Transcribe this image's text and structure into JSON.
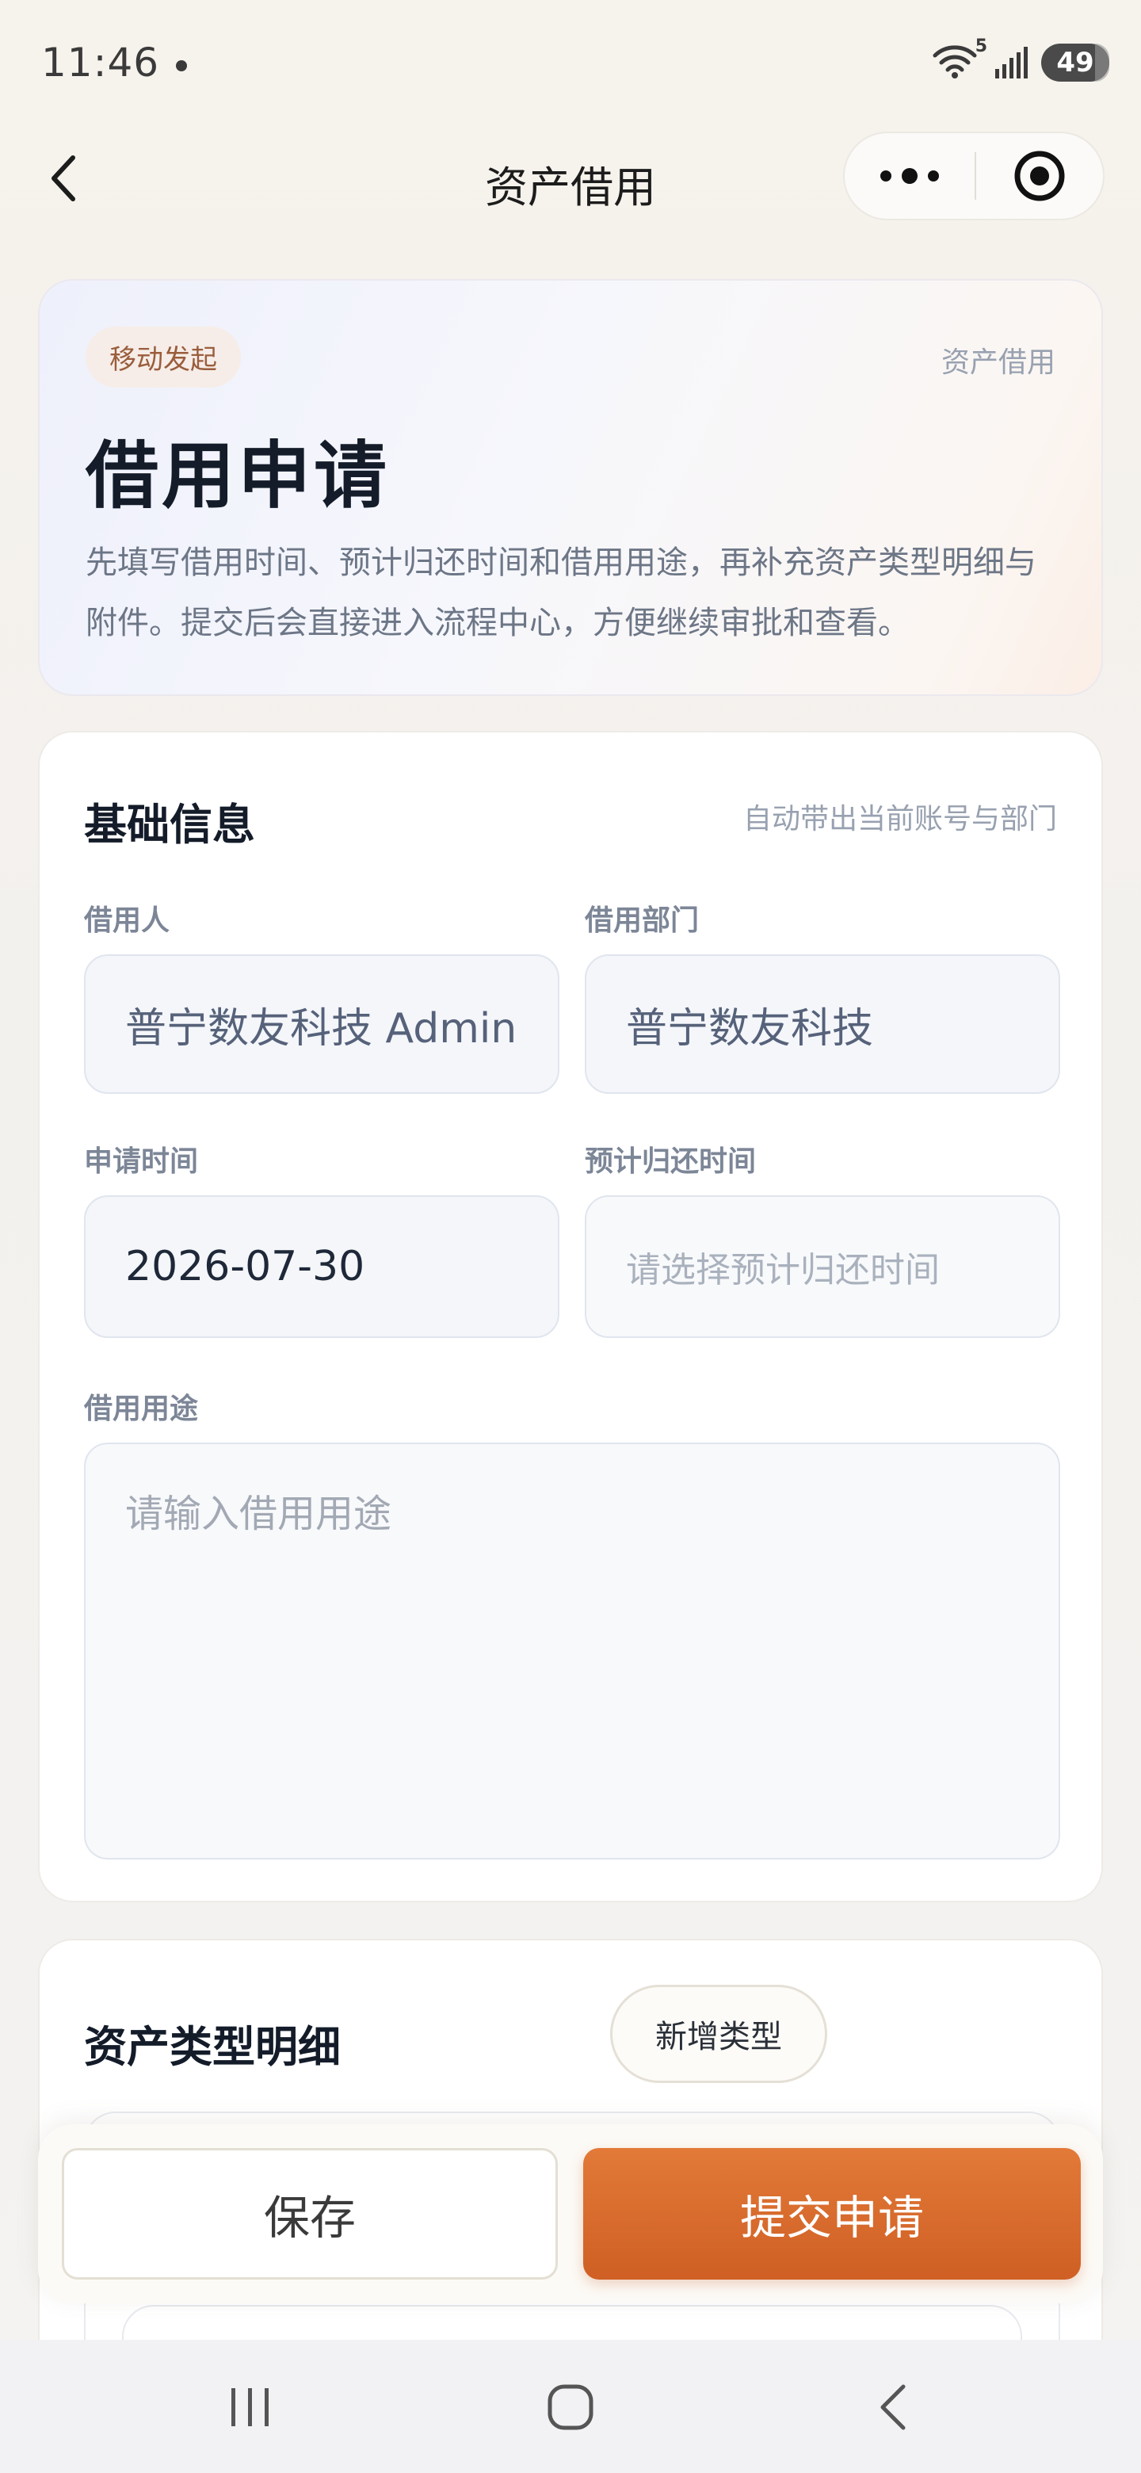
{
  "status_bar": {
    "time": "11:46",
    "wifi_badge": "5",
    "battery": "49"
  },
  "nav": {
    "title": "资产借用"
  },
  "hero": {
    "badge": "移动发起",
    "tag": "资产借用",
    "title": "借用申请",
    "description": "先填写借用时间、预计归还时间和借用用途，再补充资产类型明细与附件。提交后会直接进入流程中心，方便继续审批和查看。"
  },
  "basic_info": {
    "title": "基础信息",
    "hint": "自动带出当前账号与部门",
    "borrower": {
      "label": "借用人",
      "value": "普宁数友科技 Admin"
    },
    "department": {
      "label": "借用部门",
      "value": "普宁数友科技"
    },
    "apply_time": {
      "label": "申请时间",
      "value": "2026-07-30"
    },
    "return_time": {
      "label": "预计归还时间",
      "placeholder": "请选择预计归还时间"
    },
    "purpose": {
      "label": "借用用途",
      "placeholder": "请输入借用用途"
    }
  },
  "asset_types": {
    "title": "资产类型明细",
    "add_button": "新增类型"
  },
  "actions": {
    "save": "保存",
    "submit": "提交申请"
  },
  "colors": {
    "accent": "#d9692c",
    "page_bg": "#f4f1ec",
    "card_bg": "#ffffff"
  }
}
